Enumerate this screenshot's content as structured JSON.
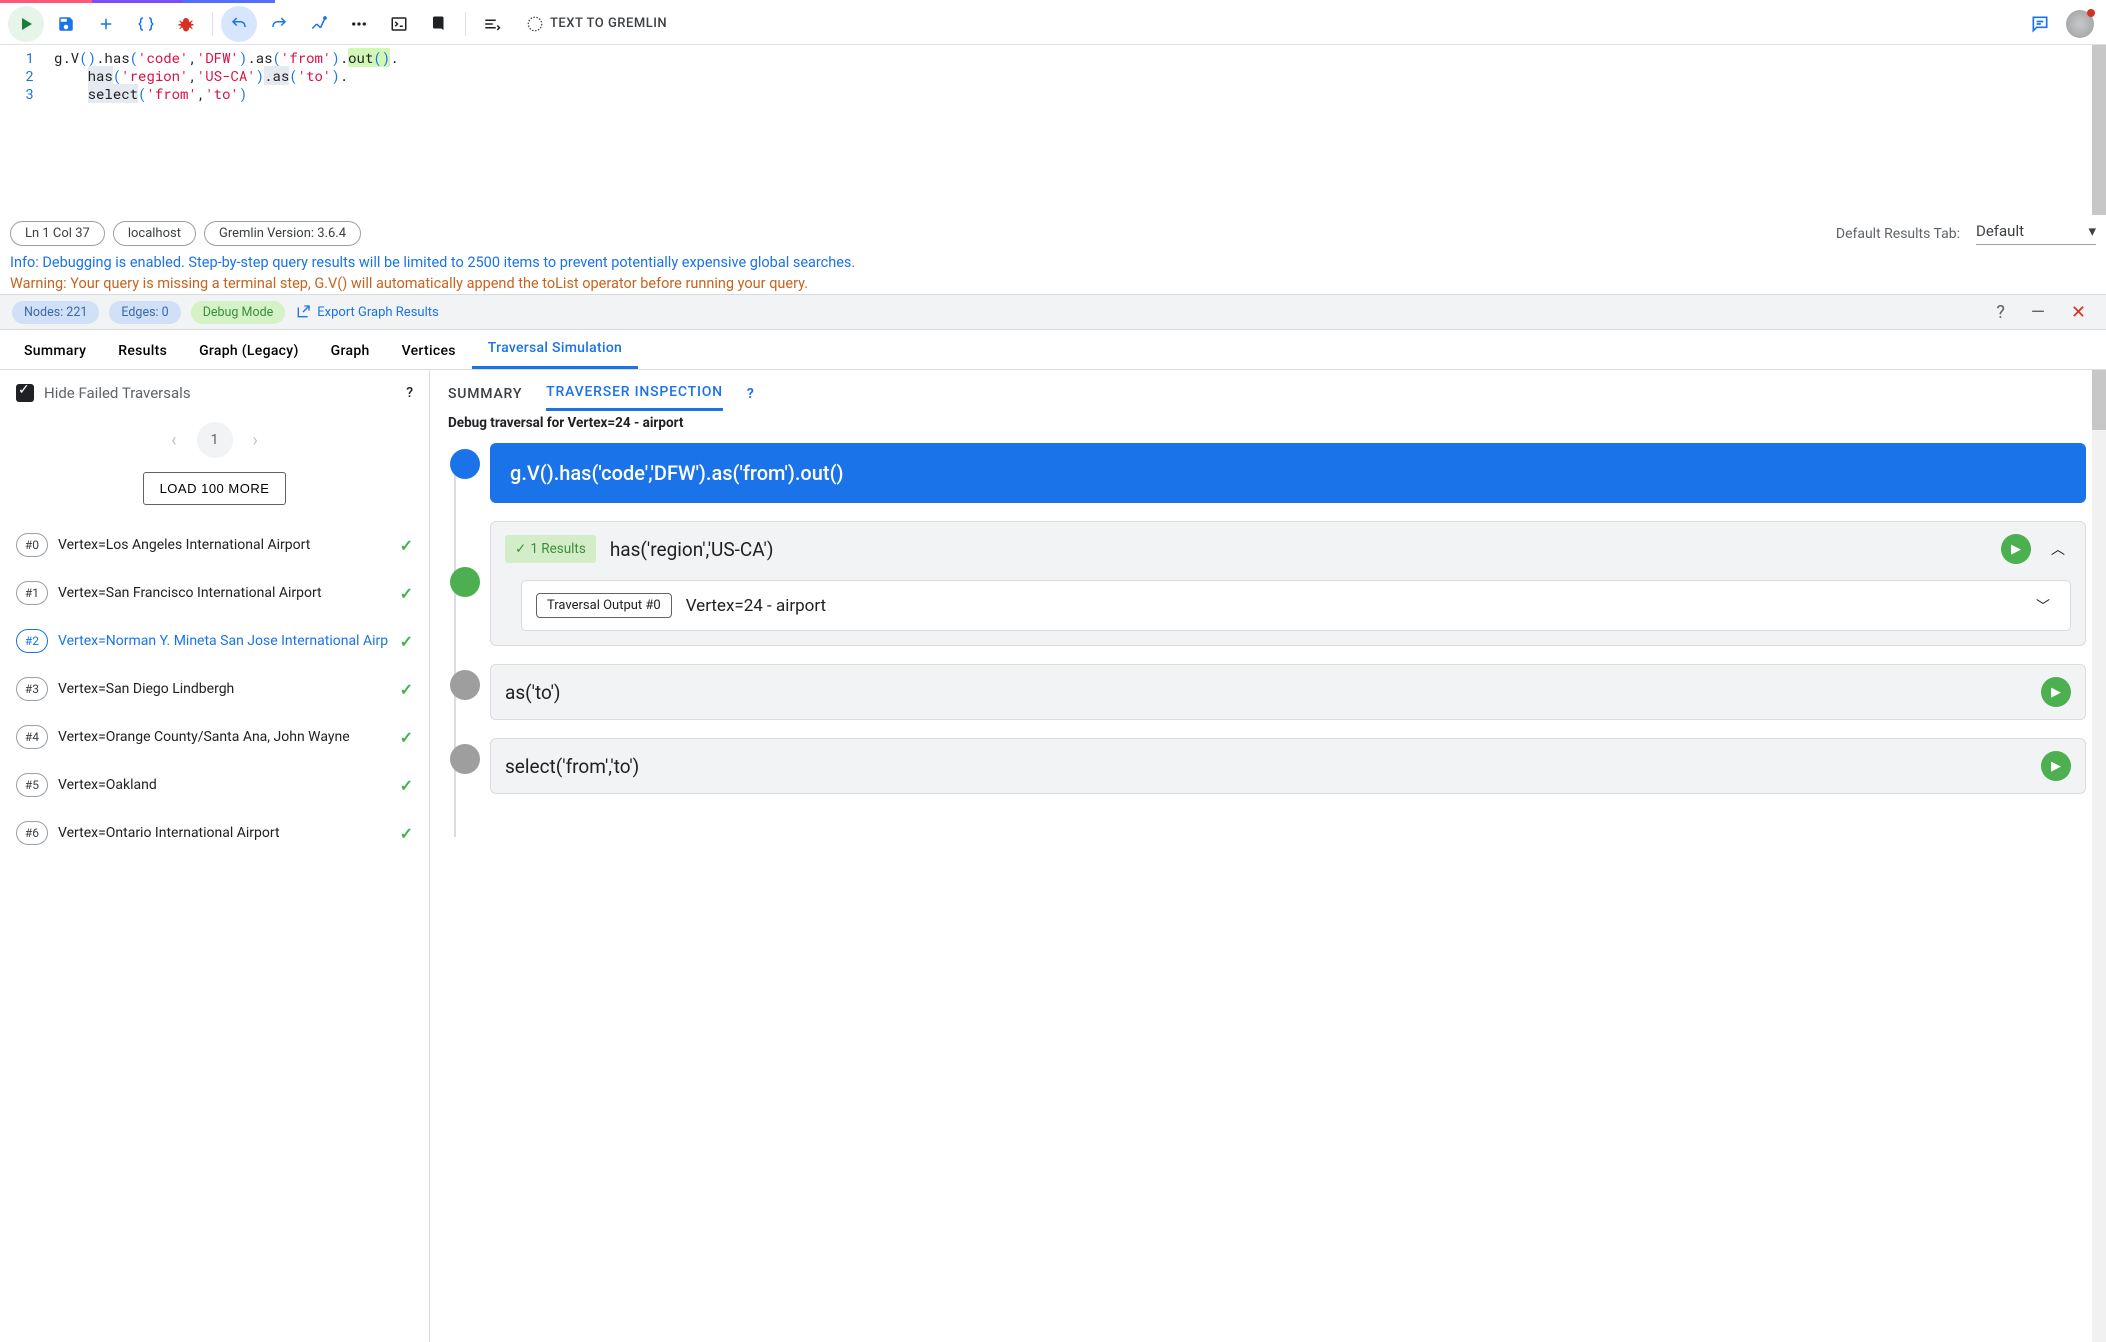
{
  "toolbar": {
    "text_to_gremlin": "TEXT TO GREMLIN"
  },
  "editor": {
    "lines": [
      "1",
      "2",
      "3"
    ]
  },
  "status": {
    "cursor": "Ln 1 Col 37",
    "host": "localhost",
    "gremlin_version": "Gremlin Version: 3.6.4",
    "default_tab_label": "Default Results Tab:",
    "default_tab_value": "Default"
  },
  "messages": {
    "info": "Info: Debugging is enabled. Step-by-step query results will be limited to 2500 items to prevent potentially expensive global searches.",
    "warning": "Warning: Your query is missing a terminal step, G.V() will automatically append the toList operator before running your query."
  },
  "result_bar": {
    "nodes": "Nodes: 221",
    "edges": "Edges: 0",
    "debug": "Debug Mode",
    "export": "Export Graph Results",
    "help": "?",
    "minimize": "—",
    "close": "✕"
  },
  "tabs": {
    "items": [
      {
        "label": "Summary"
      },
      {
        "label": "Results"
      },
      {
        "label": "Graph (Legacy)"
      },
      {
        "label": "Graph"
      },
      {
        "label": "Vertices"
      },
      {
        "label": "Traversal Simulation"
      }
    ]
  },
  "left": {
    "hide_failed": "Hide Failed Traversals",
    "help": "?",
    "page": "1",
    "load_more": "LOAD 100 MORE",
    "items": [
      {
        "idx": "#0",
        "text": "Vertex=Los Angeles International Airport"
      },
      {
        "idx": "#1",
        "text": "Vertex=San Francisco International Airport"
      },
      {
        "idx": "#2",
        "text": "Vertex=Norman Y. Mineta San Jose International Airp"
      },
      {
        "idx": "#3",
        "text": "Vertex=San Diego Lindbergh"
      },
      {
        "idx": "#4",
        "text": "Vertex=Orange County/Santa Ana, John Wayne"
      },
      {
        "idx": "#5",
        "text": "Vertex=Oakland"
      },
      {
        "idx": "#6",
        "text": "Vertex=Ontario International Airport"
      }
    ]
  },
  "right": {
    "tabs": {
      "summary": "SUMMARY",
      "inspection": "TRAVERSER INSPECTION",
      "help": "?"
    },
    "debug_title": "Debug traversal for Vertex=24 - airport",
    "steps": {
      "s0": "g.V().has('code','DFW').as('from').out()",
      "s1_results": "1 Results",
      "s1_code": "has('region','US-CA')",
      "s1_out_chip": "Traversal Output #0",
      "s1_out_text": "Vertex=24 - airport",
      "s2_code": "as('to')",
      "s3_code": "select('from','to')"
    }
  }
}
